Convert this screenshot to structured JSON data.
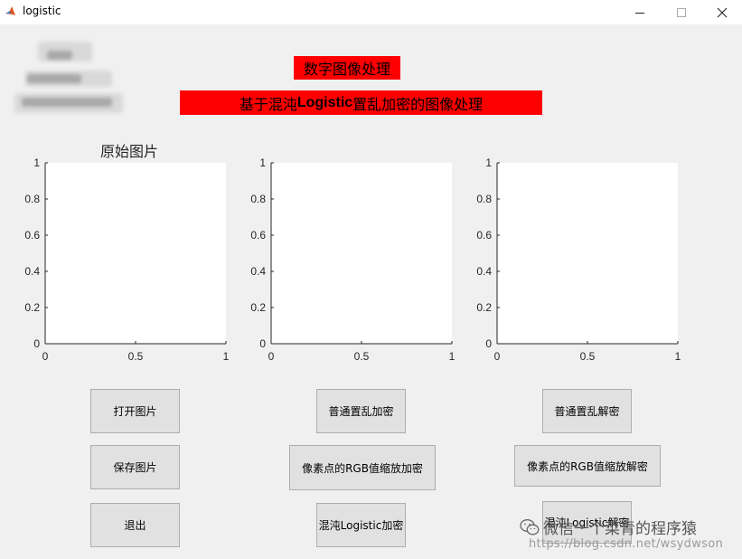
{
  "window": {
    "title": "logistic"
  },
  "header": {
    "main_title": "数字图像处理",
    "subtitle_before": "基于混沌",
    "subtitle_bold": "Logistic",
    "subtitle_after": "置乱加密的图像处理"
  },
  "axes": [
    {
      "title": "原始图片",
      "xlim": [
        0,
        1
      ],
      "ylim": [
        0,
        1
      ],
      "xticks": [
        "0",
        "0.5",
        "1"
      ],
      "yticks": [
        "0",
        "0.2",
        "0.4",
        "0.6",
        "0.8",
        "1"
      ]
    },
    {
      "title": "",
      "xlim": [
        0,
        1
      ],
      "ylim": [
        0,
        1
      ],
      "xticks": [
        "0",
        "0.5",
        "1"
      ],
      "yticks": [
        "0",
        "0.2",
        "0.4",
        "0.6",
        "0.8",
        "1"
      ]
    },
    {
      "title": "",
      "xlim": [
        0,
        1
      ],
      "ylim": [
        0,
        1
      ],
      "xticks": [
        "0",
        "0.5",
        "1"
      ],
      "yticks": [
        "0",
        "0.2",
        "0.4",
        "0.6",
        "0.8",
        "1"
      ]
    }
  ],
  "buttons": {
    "open_image": "打开图片",
    "save_image": "保存图片",
    "exit": "退出",
    "normal_scramble_encrypt": "普通置乱加密",
    "rgb_scale_encrypt": "像素点的RGB值缩放加密",
    "logistic_encrypt": "混沌Logistic加密",
    "normal_scramble_decrypt": "普通置乱解密",
    "rgb_scale_decrypt": "像素点的RGB值缩放解密",
    "logistic_decrypt": "混沌Logistic解密"
  },
  "watermark": {
    "text": "微信一个菜青的程序猿",
    "url": "https://blog.csdn.net/wsydwson"
  },
  "colors": {
    "title_bg": "#ff0000",
    "window_bg": "#f0f0f0",
    "button_bg": "#e1e1e1"
  },
  "icons": [
    "matlab-logo-icon",
    "minimize-icon",
    "maximize-icon",
    "close-icon",
    "wechat-icon"
  ]
}
